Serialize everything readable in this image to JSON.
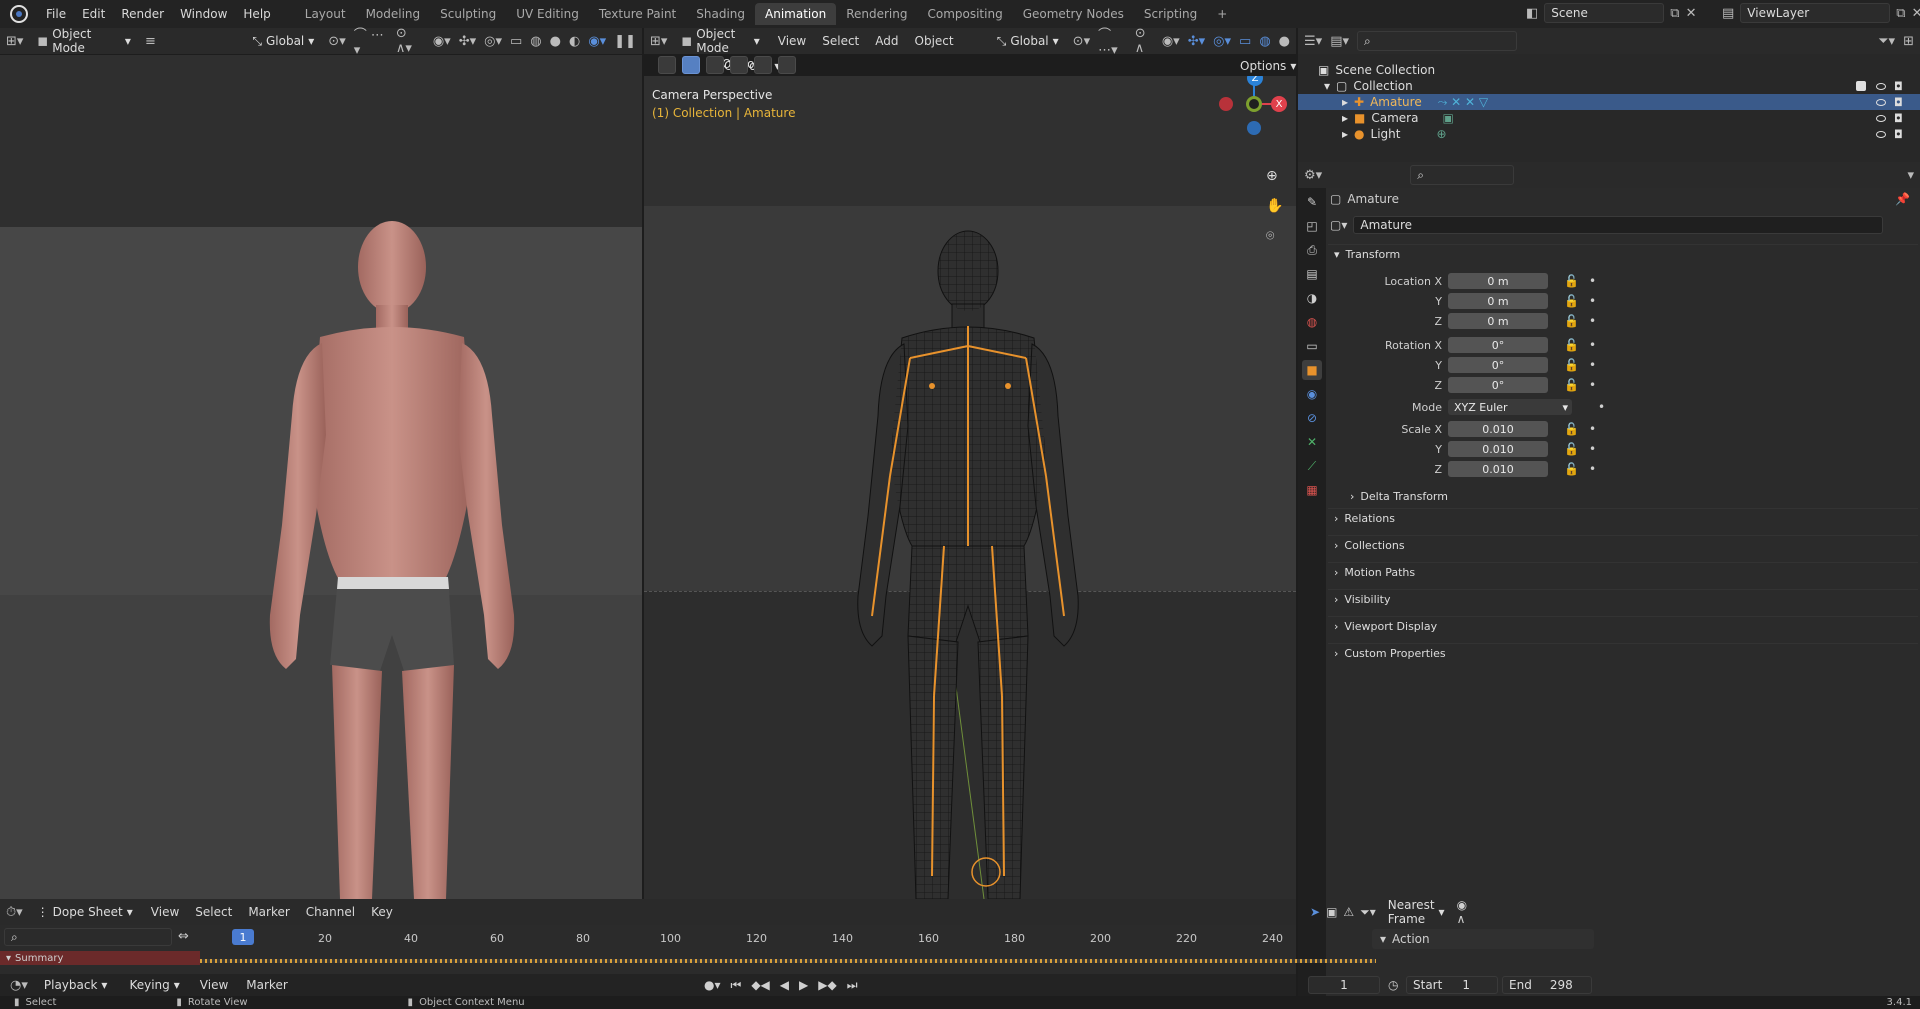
{
  "topbar": {
    "menus": [
      "File",
      "Edit",
      "Render",
      "Window",
      "Help"
    ],
    "workspaces": [
      "Layout",
      "Modeling",
      "Sculpting",
      "UV Editing",
      "Texture Paint",
      "Shading",
      "Animation",
      "Rendering",
      "Compositing",
      "Geometry Nodes",
      "Scripting"
    ],
    "active_workspace": "Animation",
    "scene": "Scene",
    "view_layer": "ViewLayer",
    "add_tab": "+"
  },
  "left_editor": {
    "mode": "Object Mode",
    "transform": "Global",
    "options": "Options"
  },
  "right_editor": {
    "mode": "Object Mode",
    "menus": [
      "View",
      "Select",
      "Add",
      "Object"
    ],
    "transform": "Global",
    "options": "Options",
    "viewport_title": "Camera Perspective",
    "viewport_sub": "(1) Collection | Amature"
  },
  "gizmo": {
    "z": "Z",
    "x": "X"
  },
  "outliner": {
    "scene_collection": "Scene Collection",
    "collection": "Collection",
    "items": [
      "Amature",
      "Camera",
      "Light"
    ]
  },
  "properties": {
    "object_name": "Amature",
    "data_name": "Amature",
    "transform_header": "Transform",
    "location_label": "Location X",
    "location": [
      "0 m",
      "0 m",
      "0 m"
    ],
    "rotation_label": "Rotation X",
    "rotation": [
      "0°",
      "0°",
      "0°"
    ],
    "mode_label": "Mode",
    "mode_value": "XYZ Euler",
    "scale_label": "Scale X",
    "scale": [
      "0.010",
      "0.010",
      "0.010"
    ],
    "axis_y": "Y",
    "axis_z": "Z",
    "panels": [
      "Delta Transform",
      "Relations",
      "Collections",
      "Motion Paths",
      "Visibility",
      "Viewport Display",
      "Custom Properties"
    ]
  },
  "dopesheet": {
    "editor": "Dope Sheet",
    "menus": [
      "View",
      "Select",
      "Marker",
      "Channel",
      "Key"
    ],
    "snap": "Nearest Frame",
    "summary": "Summary",
    "action": "Action",
    "current_frame": "1",
    "ticks": [
      "20",
      "40",
      "60",
      "80",
      "100",
      "120",
      "140",
      "160",
      "180",
      "200",
      "220",
      "240"
    ]
  },
  "timeline": {
    "menus": [
      "Playback",
      "Keying",
      "View",
      "Marker"
    ],
    "frame": "1",
    "start_label": "Start",
    "start": "1",
    "end_label": "End",
    "end": "298"
  },
  "status": {
    "select": "Select",
    "rotate": "Rotate View",
    "context": "Object Context Menu",
    "version": "3.4.1"
  }
}
